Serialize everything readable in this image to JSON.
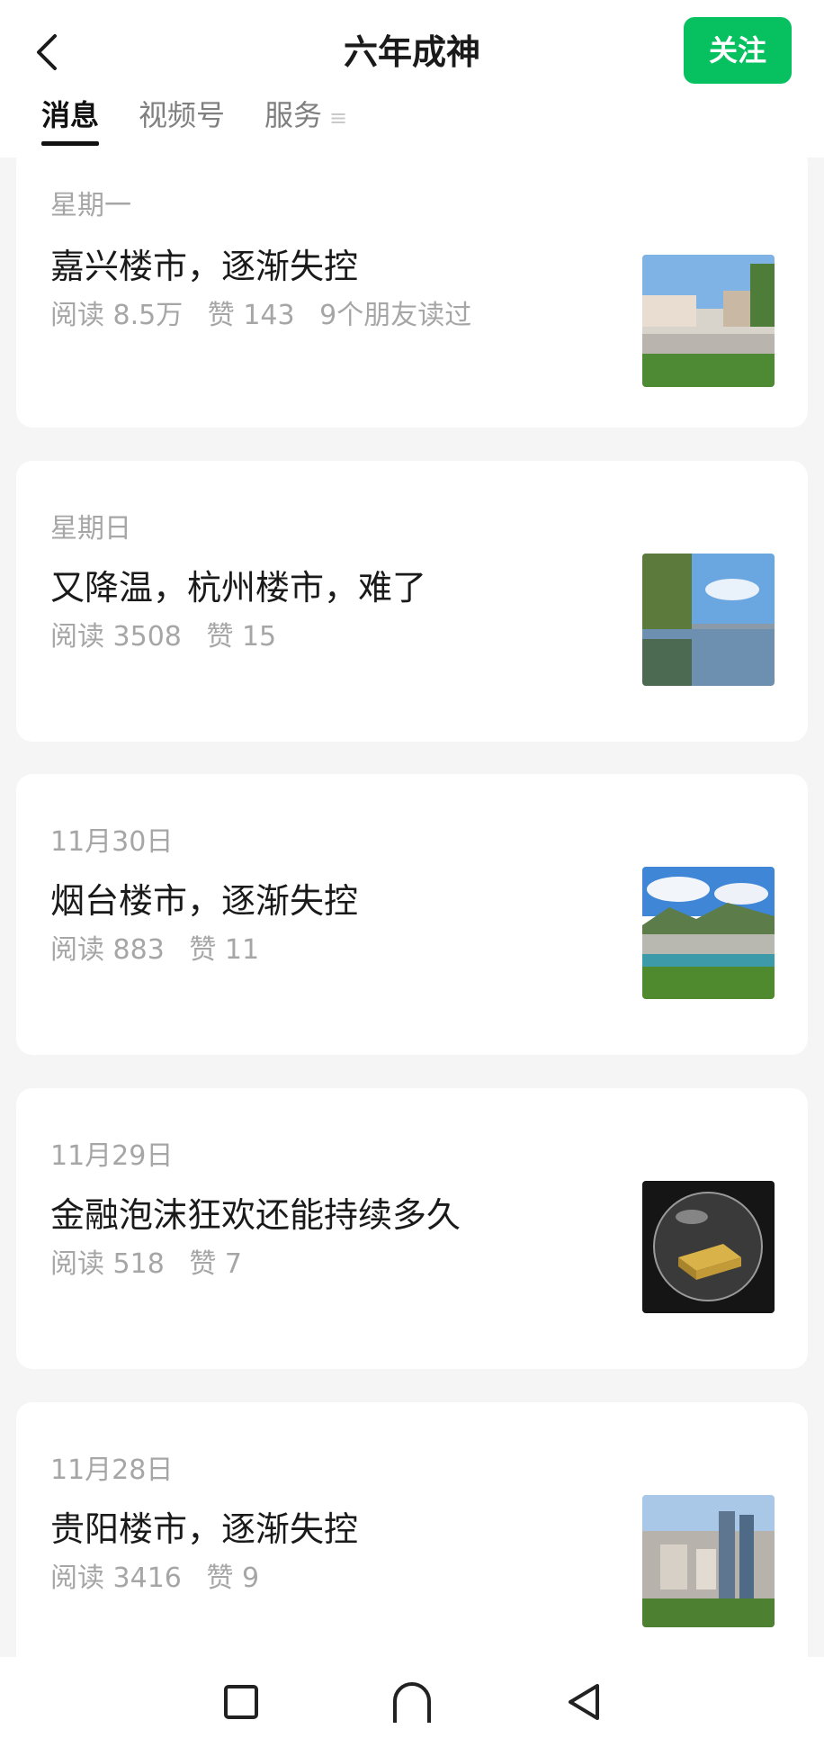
{
  "header": {
    "back_icon": "chevron-left-icon",
    "title": "六年成神",
    "follow_label": "关注",
    "accent_color": "#07c160"
  },
  "tabs": [
    {
      "label": "消息",
      "active": true
    },
    {
      "label": "视频号",
      "active": false
    },
    {
      "label": "服务",
      "active": false,
      "trailing_glyph": "≡"
    }
  ],
  "articles": [
    {
      "date": "星期一",
      "title": "嘉兴楼市，逐渐失控",
      "reads": "阅读 8.5万",
      "likes": "赞 143",
      "friends": "9个朋友读过",
      "thumb": "street-photo"
    },
    {
      "date": "星期日",
      "title": "又降温，杭州楼市，难了",
      "reads": "阅读 3508",
      "likes": "赞 15",
      "thumb": "lake-photo"
    },
    {
      "date": "11月30日",
      "title": "烟台楼市，逐渐失控",
      "reads": "阅读 883",
      "likes": "赞 11",
      "thumb": "city-river-photo"
    },
    {
      "date": "11月29日",
      "title": "金融泡沫狂欢还能持续多久",
      "reads": "阅读 518",
      "likes": "赞 7",
      "thumb": "gold-bubble-photo"
    },
    {
      "date": "11月28日",
      "title": "贵阳楼市，逐渐失控",
      "reads": "阅读 3416",
      "likes": "赞 9",
      "thumb": "skyline-photo"
    }
  ],
  "navbar": {
    "icons": [
      "square-recents-icon",
      "arch-home-icon",
      "triangle-back-icon"
    ]
  }
}
